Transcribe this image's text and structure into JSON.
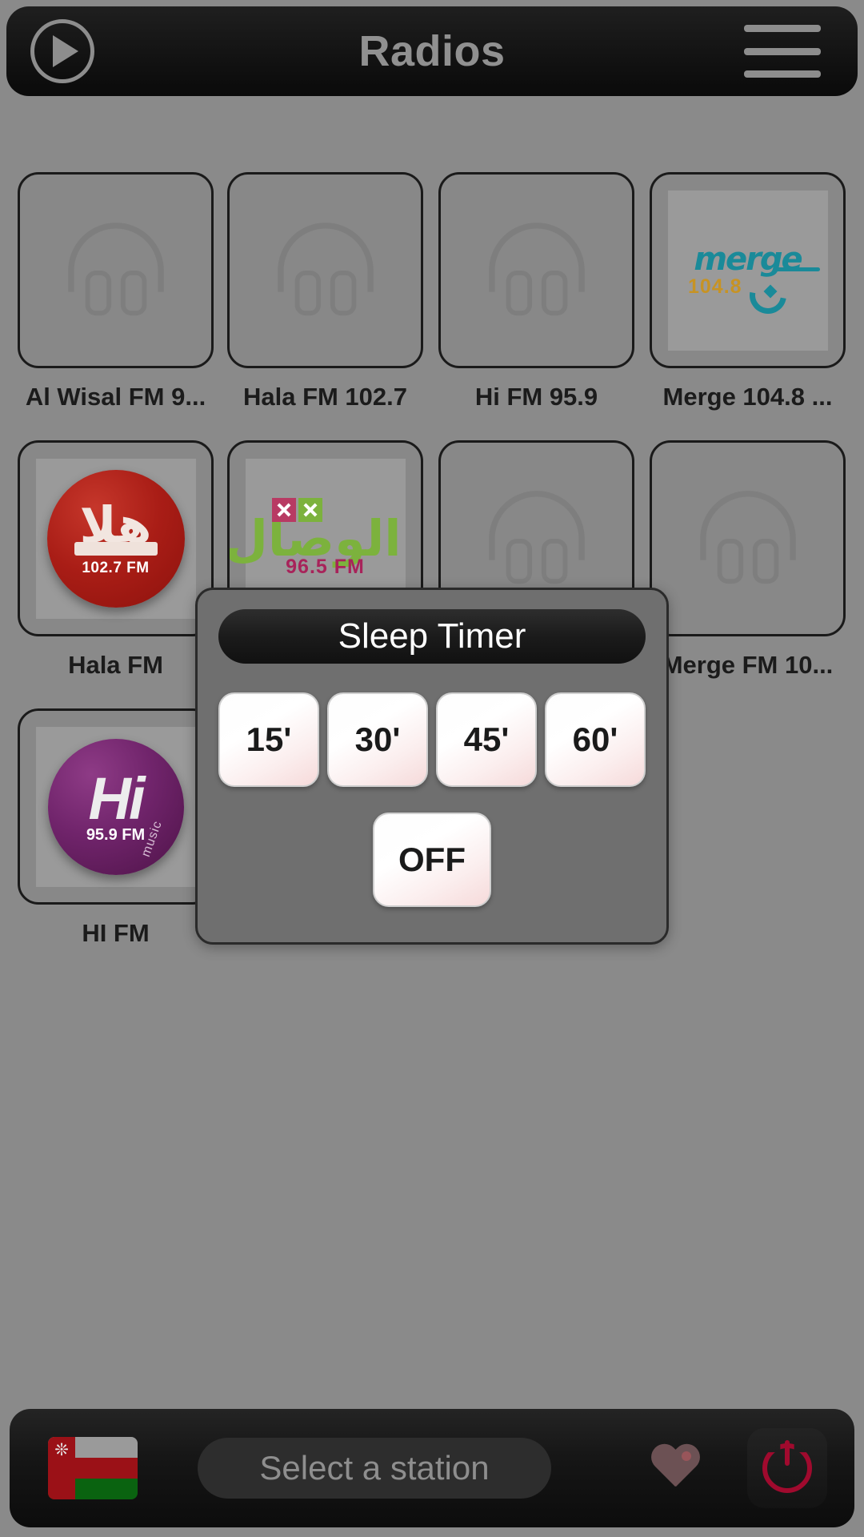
{
  "header": {
    "title": "Radios",
    "play_icon": "play-icon",
    "menu_icon": "hamburger-menu-icon"
  },
  "stations": {
    "rows": [
      [
        {
          "label": "Al Wisal FM 9...",
          "logo": "placeholder-headphones"
        },
        {
          "label": "Hala FM 102.7",
          "logo": "placeholder-headphones"
        },
        {
          "label": "Hi FM 95.9",
          "logo": "placeholder-headphones"
        },
        {
          "label": "Merge 104.8 ...",
          "logo": "merge"
        }
      ],
      [
        {
          "label": "Hala FM",
          "logo": "hala"
        },
        {
          "label": "",
          "logo": "wisal"
        },
        {
          "label": "",
          "logo": "placeholder-headphones"
        },
        {
          "label": "Merge FM 10...",
          "logo": "placeholder-headphones"
        }
      ],
      [
        {
          "label": "HI FM",
          "logo": "hi"
        }
      ]
    ],
    "logos": {
      "merge": {
        "word": "merge",
        "freq": "104.8",
        "color": "#1a8a99",
        "freq_color": "#c79324"
      },
      "hala": {
        "script": "هلا",
        "freq": "102.7 FM",
        "color": "#a91d16"
      },
      "wisal": {
        "arabic": "الوصال",
        "freq": "96.5 FM",
        "color": "#7cb23d",
        "freq_color": "#a8235a"
      },
      "hi": {
        "word": "Hi",
        "freq": "95.9 FM",
        "sub": "music",
        "color": "#70246b"
      }
    }
  },
  "dialog": {
    "title": "Sleep Timer",
    "options": [
      "15'",
      "30'",
      "45'",
      "60'"
    ],
    "off_label": "OFF"
  },
  "bottombar": {
    "flag": "oman-flag",
    "station_placeholder": "Select a station",
    "favorite_icon": "heart-icon",
    "power_icon": "power-icon"
  },
  "colors": {
    "background": "#8a8a8a",
    "bar": "#151515",
    "accent_red": "#a00a2e",
    "dialog_bg": "#6f6f6f"
  }
}
